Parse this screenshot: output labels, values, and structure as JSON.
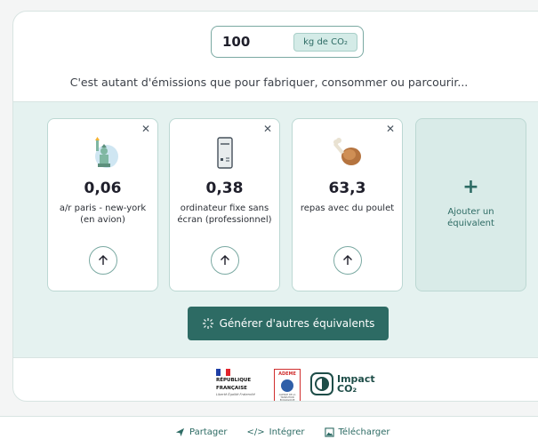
{
  "input": {
    "value": "100",
    "unit": "kg de CO₂"
  },
  "intro_text": "C'est autant d'émissions que pour fabriquer, consommer ou parcourir...",
  "equivalents": [
    {
      "value": "0,06",
      "label": "a/r paris - new-york (en avion)",
      "icon": "statue-of-liberty-icon"
    },
    {
      "value": "0,38",
      "label": "ordinateur fixe sans écran (professionnel)",
      "icon": "desktop-computer-icon"
    },
    {
      "value": "63,3",
      "label": "repas avec du poulet",
      "icon": "chicken-leg-icon"
    }
  ],
  "add_card": {
    "plus": "+",
    "label": "Ajouter un équivalent"
  },
  "generate_button": {
    "label": "Générer d'autres équivalents"
  },
  "logos": {
    "republique": {
      "line1": "RÉPUBLIQUE",
      "line2": "FRANÇAISE",
      "motto": "Liberté Égalité Fraternité"
    },
    "ademe": {
      "name": "ADEME",
      "sub": "AGENCE DE LA TRANSITION ÉCOLOGIQUE"
    },
    "impact": {
      "line1": "Impact",
      "line2": "CO₂"
    }
  },
  "footer": {
    "share": "Partager",
    "embed": "Intégrer",
    "download": "Télécharger"
  },
  "colors": {
    "accent": "#2d6b64",
    "panel": "#e5f2f0",
    "border": "#bcd8d3"
  }
}
